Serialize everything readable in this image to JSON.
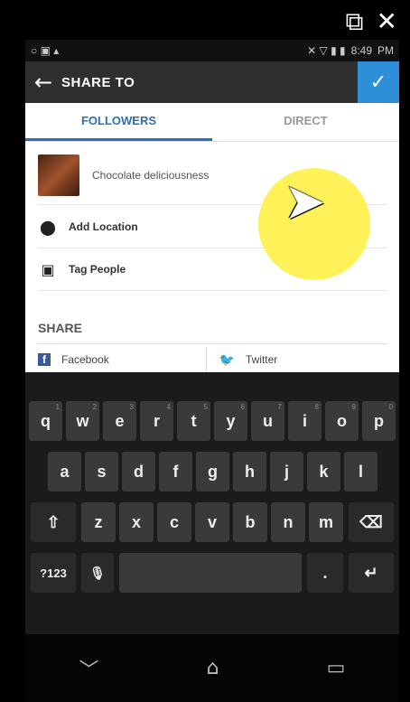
{
  "window_controls": {
    "popout_icon": "popout-icon",
    "popout_glyph": "⧉",
    "close_glyph": "✕"
  },
  "statusbar": {
    "time": "8:49",
    "ampm": "PM"
  },
  "appbar": {
    "title": "SHARE TO",
    "back_glyph": "←",
    "confirm_glyph": "✓"
  },
  "tabs": [
    {
      "label": "FOLLOWERS"
    },
    {
      "label": "DIRECT"
    }
  ],
  "post": {
    "caption": "Chocolate deliciousness"
  },
  "options": {
    "add_location": "Add Location",
    "tag_people": "Tag People"
  },
  "share": {
    "heading": "SHARE",
    "facebook": "Facebook",
    "twitter": "Twitter"
  },
  "keyboard": {
    "row1": [
      {
        "k": "q",
        "n": "1"
      },
      {
        "k": "w",
        "n": "2"
      },
      {
        "k": "e",
        "n": "3"
      },
      {
        "k": "r",
        "n": "4"
      },
      {
        "k": "t",
        "n": "5"
      },
      {
        "k": "y",
        "n": "6"
      },
      {
        "k": "u",
        "n": "7"
      },
      {
        "k": "i",
        "n": "8"
      },
      {
        "k": "o",
        "n": "9"
      },
      {
        "k": "p",
        "n": "0"
      }
    ],
    "row2": [
      "a",
      "s",
      "d",
      "f",
      "g",
      "h",
      "j",
      "k",
      "l"
    ],
    "row3": [
      "z",
      "x",
      "c",
      "v",
      "b",
      "n",
      "m"
    ],
    "shift_glyph": "⇧",
    "backspace_glyph": "⌫",
    "num_label": "?123",
    "mic_glyph": "🎙",
    "period": ".",
    "enter_glyph": "↵"
  },
  "navbar": {
    "back_glyph": "﹀",
    "home_glyph": "⌂",
    "recents_glyph": "▭"
  }
}
